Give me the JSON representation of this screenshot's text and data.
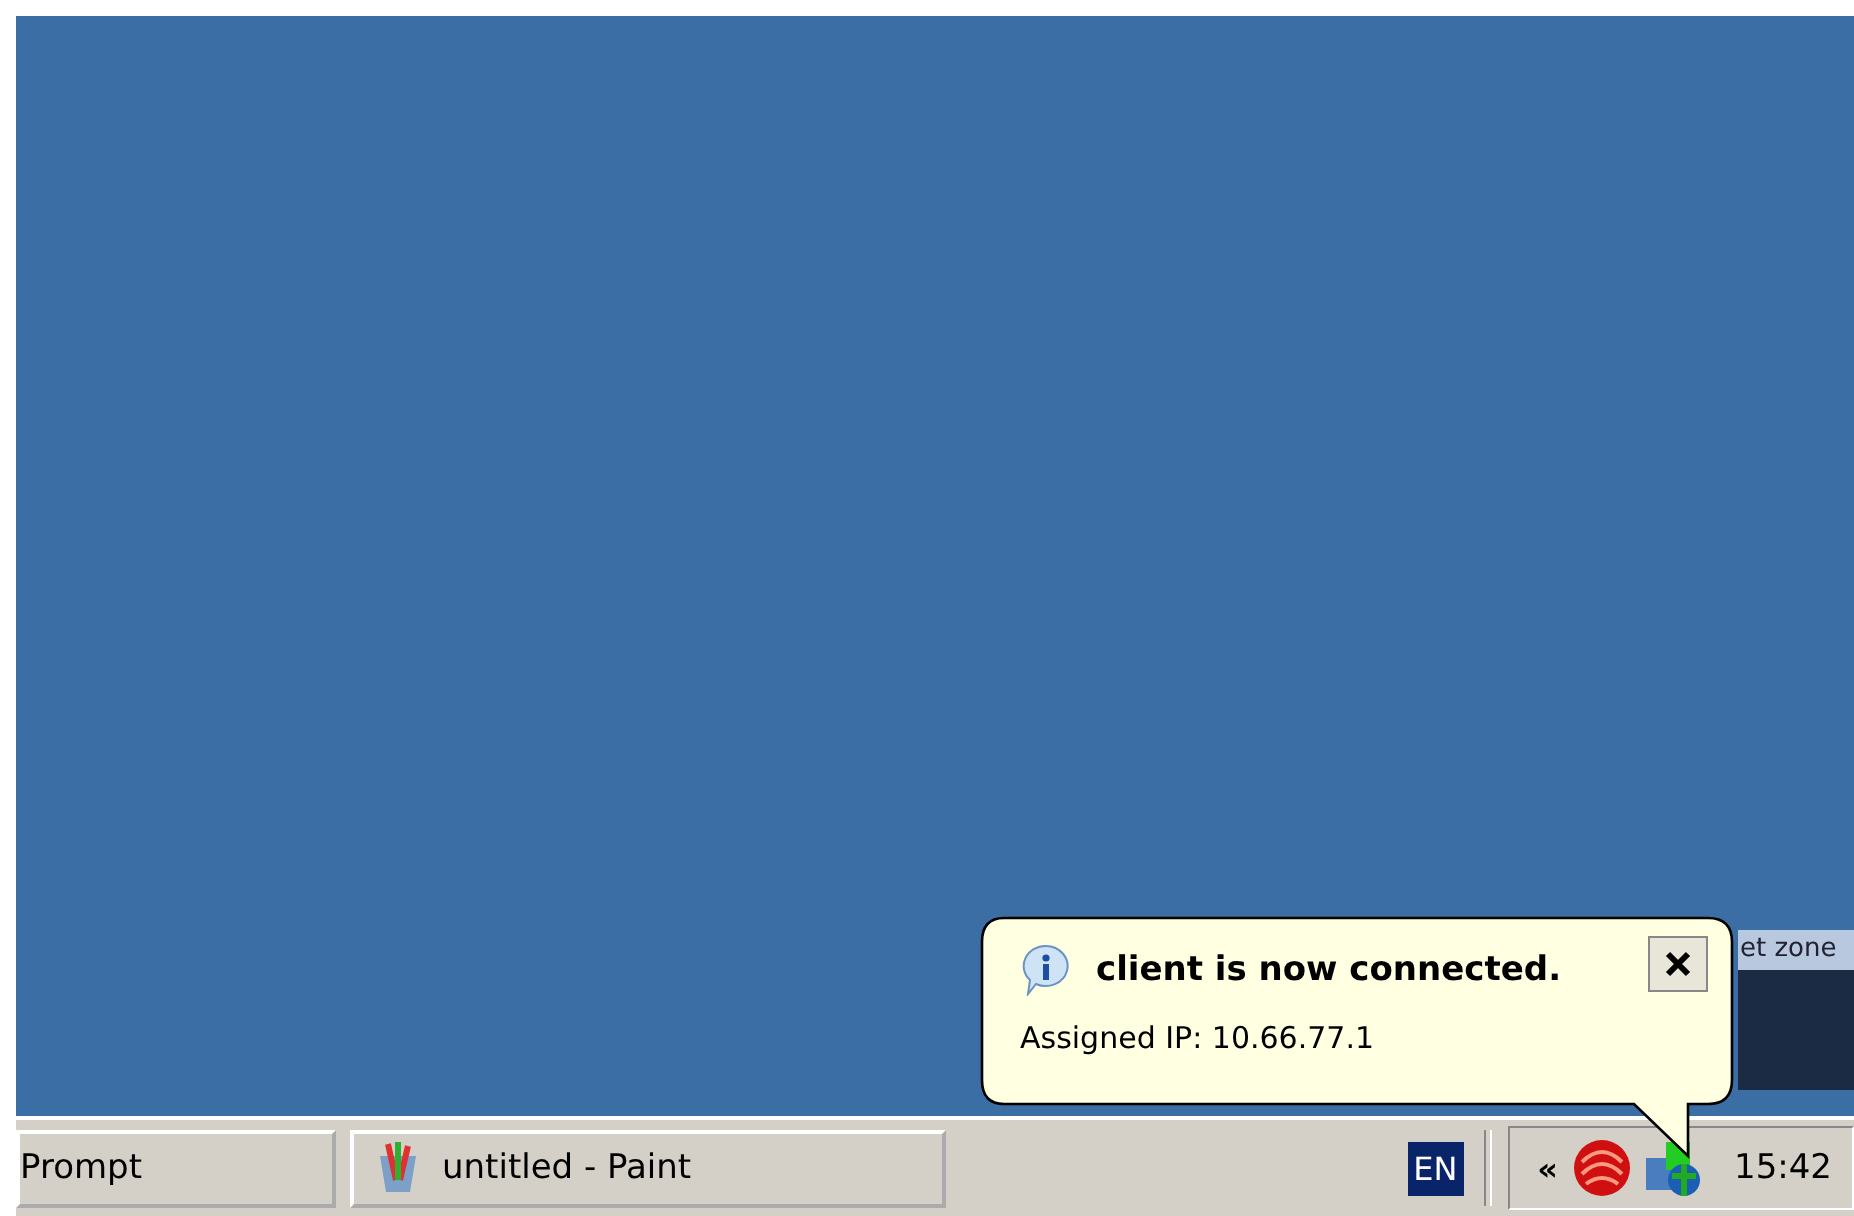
{
  "background_window": {
    "title": "et zone"
  },
  "balloon": {
    "title": "client is now connected.",
    "message": "Assigned IP: 10.66.77.1"
  },
  "taskbar": {
    "buttons": [
      {
        "label": "Prompt",
        "kind": "plain"
      },
      {
        "label": "untitled - Paint",
        "kind": "paint"
      }
    ],
    "language": "EN",
    "tray": {
      "expand": "«",
      "clock": "15:42"
    }
  }
}
